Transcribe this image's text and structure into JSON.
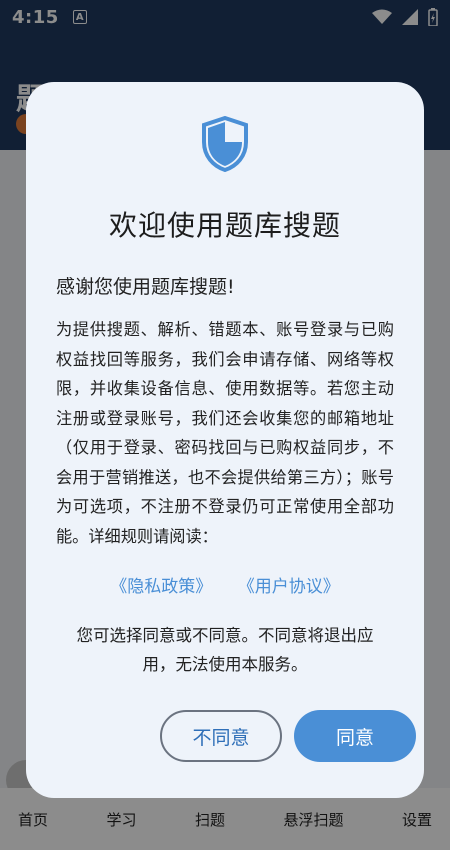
{
  "status_bar": {
    "time": "4:15",
    "notification_glyph": "A",
    "icons": [
      "wifi-icon",
      "signal-icon",
      "battery-charging-icon"
    ]
  },
  "app": {
    "title": "题库搜题",
    "nav": [
      "首页",
      "学习",
      "扫题",
      "悬浮扫题",
      "设置"
    ]
  },
  "dialog": {
    "icon": "shield-icon",
    "title": "欢迎使用题库搜题",
    "greeting": "感谢您使用题库搜题!",
    "body": "为提供搜题、解析、错题本、账号登录与已购权益找回等服务，我们会申请存储、网络等权限，并收集设备信息、使用数据等。若您主动注册或登录账号，我们还会收集您的邮箱地址（仅用于登录、密码找回与已购权益同步，不会用于营销推送，也不会提供给第三方）；账号为可选项，不注册不登录仍可正常使用全部功能。详细规则请阅读：",
    "privacy_link": "《隐私政策》",
    "terms_link": "《用户协议》",
    "choice_note": "您可选择同意或不同意。不同意将退出应用，无法使用本服务。",
    "decline_label": "不同意",
    "agree_label": "同意"
  },
  "colors": {
    "header": "#1f3a5f",
    "dialog_bg": "#eef3fa",
    "accent": "#4a8fd6"
  }
}
